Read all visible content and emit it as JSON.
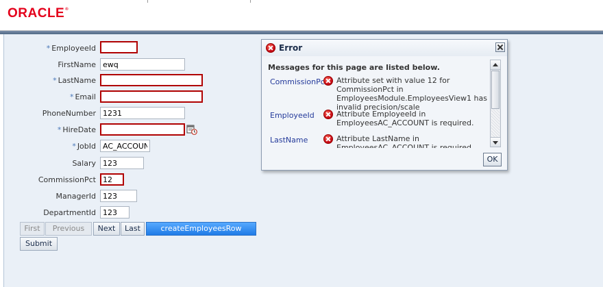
{
  "header": {
    "logo": "ORACLE",
    "logo_mark": "®"
  },
  "form": {
    "fields": [
      {
        "label": "EmployeeId",
        "required": true,
        "value": "",
        "error": true
      },
      {
        "label": "FirstName",
        "required": false,
        "value": "ewq",
        "error": false
      },
      {
        "label": "LastName",
        "required": true,
        "value": "",
        "error": true
      },
      {
        "label": "Email",
        "required": true,
        "value": "",
        "error": true
      },
      {
        "label": "PhoneNumber",
        "required": false,
        "value": "1231",
        "error": false
      },
      {
        "label": "HireDate",
        "required": true,
        "value": "",
        "error": true
      },
      {
        "label": "JobId",
        "required": true,
        "value": "AC_ACCOUNT",
        "error": false
      },
      {
        "label": "Salary",
        "required": false,
        "value": "123",
        "error": false
      },
      {
        "label": "CommissionPct",
        "required": false,
        "value": "12",
        "error": true
      },
      {
        "label": "ManagerId",
        "required": false,
        "value": "123",
        "error": false
      },
      {
        "label": "DepartmentId",
        "required": false,
        "value": "123",
        "error": false
      }
    ],
    "required_marker": "*",
    "pager": {
      "first": "First",
      "previous": "Previous",
      "next": "Next",
      "last": "Last",
      "create": "createEmployeesRow"
    },
    "submit": "Submit"
  },
  "dialog": {
    "title": "Error",
    "heading": "Messages for this page are listed below.",
    "messages": [
      {
        "field": "CommissionPct",
        "text": "Attribute set with value 12 for CommissionPct in EmployeesModule.EmployeesView1 has invalid precision/scale"
      },
      {
        "field": "EmployeeId",
        "text": "Attribute EmployeeId in EmployeesAC_ACCOUNT is required."
      },
      {
        "field": "LastName",
        "text": "Attribute LastName in EmployeesAC_ACCOUNT is required."
      }
    ],
    "ok": "OK"
  },
  "colors": {
    "brand": "#e4001b",
    "error_border": "#b00000",
    "primary_button": "#1f7be6",
    "link": "#23399a"
  }
}
